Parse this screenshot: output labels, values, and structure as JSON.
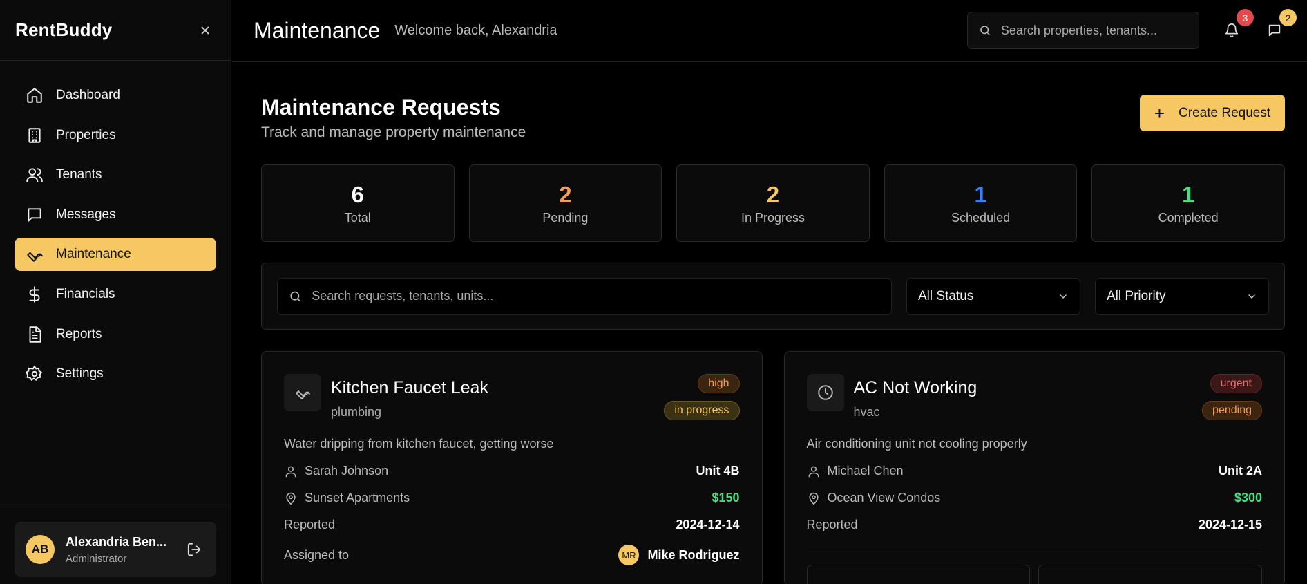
{
  "sidebar": {
    "brand": "RentBuddy",
    "items": [
      {
        "label": "Dashboard",
        "icon": "home-icon"
      },
      {
        "label": "Properties",
        "icon": "building-icon"
      },
      {
        "label": "Tenants",
        "icon": "users-icon"
      },
      {
        "label": "Messages",
        "icon": "message-icon"
      },
      {
        "label": "Maintenance",
        "icon": "wrench-icon",
        "active": true
      },
      {
        "label": "Financials",
        "icon": "dollar-icon"
      },
      {
        "label": "Reports",
        "icon": "file-icon"
      },
      {
        "label": "Settings",
        "icon": "gear-icon"
      }
    ],
    "user": {
      "initials": "AB",
      "name": "Alexandria Ben...",
      "role": "Administrator"
    }
  },
  "header": {
    "title": "Maintenance",
    "welcome": "Welcome back, Alexandria",
    "search_placeholder": "Search properties, tenants...",
    "notifications_count": "3",
    "messages_count": "2"
  },
  "main": {
    "title": "Maintenance Requests",
    "subtitle": "Track and manage property maintenance",
    "create_label": "Create Request",
    "stats": [
      {
        "value": "6",
        "label": "Total",
        "color": "#ffffff"
      },
      {
        "value": "2",
        "label": "Pending",
        "color": "#f49b56"
      },
      {
        "value": "2",
        "label": "In Progress",
        "color": "#f6c864"
      },
      {
        "value": "1",
        "label": "Scheduled",
        "color": "#3b82f6"
      },
      {
        "value": "1",
        "label": "Completed",
        "color": "#4ade80"
      }
    ],
    "filter_search_placeholder": "Search requests, tenants, units...",
    "status_filter": "All Status",
    "priority_filter": "All Priority",
    "cards": [
      {
        "title": "Kitchen Faucet Leak",
        "category": "plumbing",
        "priority": "high",
        "status": "in progress",
        "description": "Water dripping from kitchen faucet, getting worse",
        "tenant": "Sarah Johnson",
        "unit": "Unit 4B",
        "property": "Sunset Apartments",
        "cost": "$150",
        "reported_label": "Reported",
        "reported": "2024-12-14",
        "assigned_label": "Assigned to",
        "assignee_initials": "MR",
        "assignee": "Mike Rodriguez"
      },
      {
        "title": "AC Not Working",
        "category": "hvac",
        "priority": "urgent",
        "status": "pending",
        "description": "Air conditioning unit not cooling properly",
        "tenant": "Michael Chen",
        "unit": "Unit 2A",
        "property": "Ocean View Condos",
        "cost": "$300",
        "reported_label": "Reported",
        "reported": "2024-12-15"
      }
    ]
  }
}
